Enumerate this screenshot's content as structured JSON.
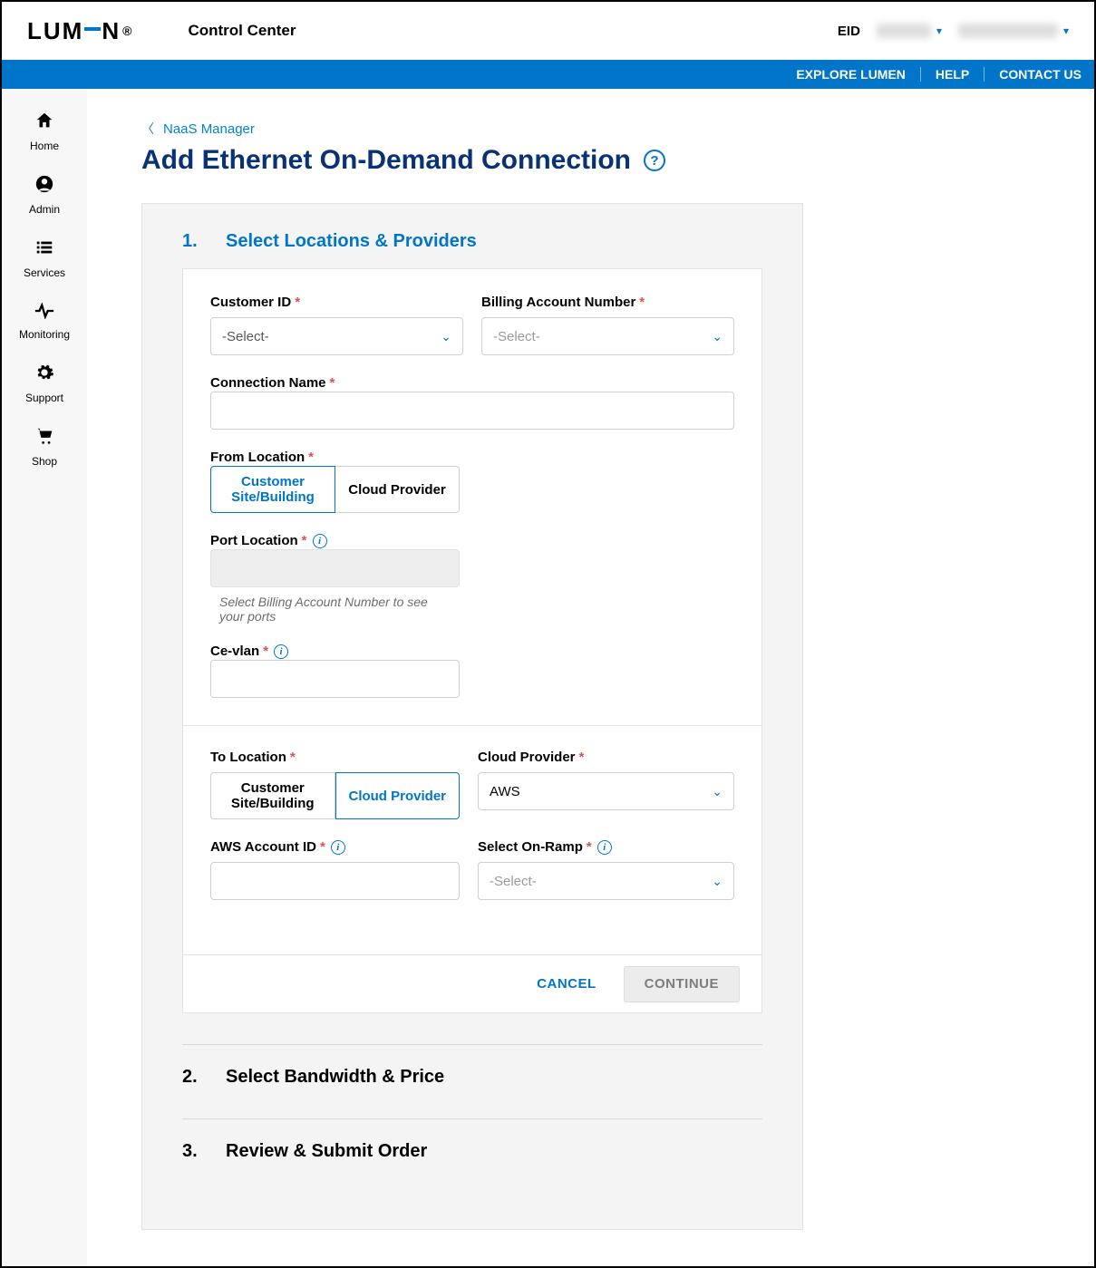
{
  "header": {
    "logo_text_pre": "LUM",
    "logo_text_post": "N",
    "app_name": "Control Center",
    "eid_label": "EID"
  },
  "bluebar": {
    "explore": "EXPLORE LUMEN",
    "help": "HELP",
    "contact": "CONTACT US"
  },
  "sidenav": [
    {
      "icon": "⌂",
      "label": "Home"
    },
    {
      "icon": "☻",
      "label": "Admin"
    },
    {
      "icon": "≣",
      "label": "Services"
    },
    {
      "icon": "〰",
      "label": "Monitoring"
    },
    {
      "icon": "⚙",
      "label": "Support"
    },
    {
      "icon": "🛒",
      "label": "Shop"
    }
  ],
  "breadcrumb": {
    "label": "NaaS Manager"
  },
  "page_title": "Add Ethernet On-Demand Connection",
  "steps": {
    "s1": {
      "num": "1.",
      "title": "Select Locations & Providers"
    },
    "s2": {
      "num": "2.",
      "title": "Select Bandwidth & Price"
    },
    "s3": {
      "num": "3.",
      "title": "Review & Submit Order"
    }
  },
  "form": {
    "customer_id": {
      "label": "Customer ID",
      "placeholder": "-Select-"
    },
    "ban": {
      "label": "Billing Account Number",
      "placeholder": "-Select-"
    },
    "conn_name": {
      "label": "Connection Name"
    },
    "from_loc": {
      "label": "From Location",
      "opt1": "Customer Site/Building",
      "opt2": "Cloud Provider"
    },
    "port_loc": {
      "label": "Port Location",
      "help": "Select Billing Account Number to see your ports"
    },
    "ce_vlan": {
      "label": "Ce-vlan"
    },
    "to_loc": {
      "label": "To Location",
      "opt1": "Customer Site/Building",
      "opt2": "Cloud Provider"
    },
    "cloud_provider": {
      "label": "Cloud Provider",
      "value": "AWS"
    },
    "aws_acct": {
      "label": "AWS Account ID"
    },
    "on_ramp": {
      "label": "Select On-Ramp",
      "placeholder": "-Select-"
    }
  },
  "actions": {
    "cancel": "CANCEL",
    "continue": "CONTINUE"
  }
}
